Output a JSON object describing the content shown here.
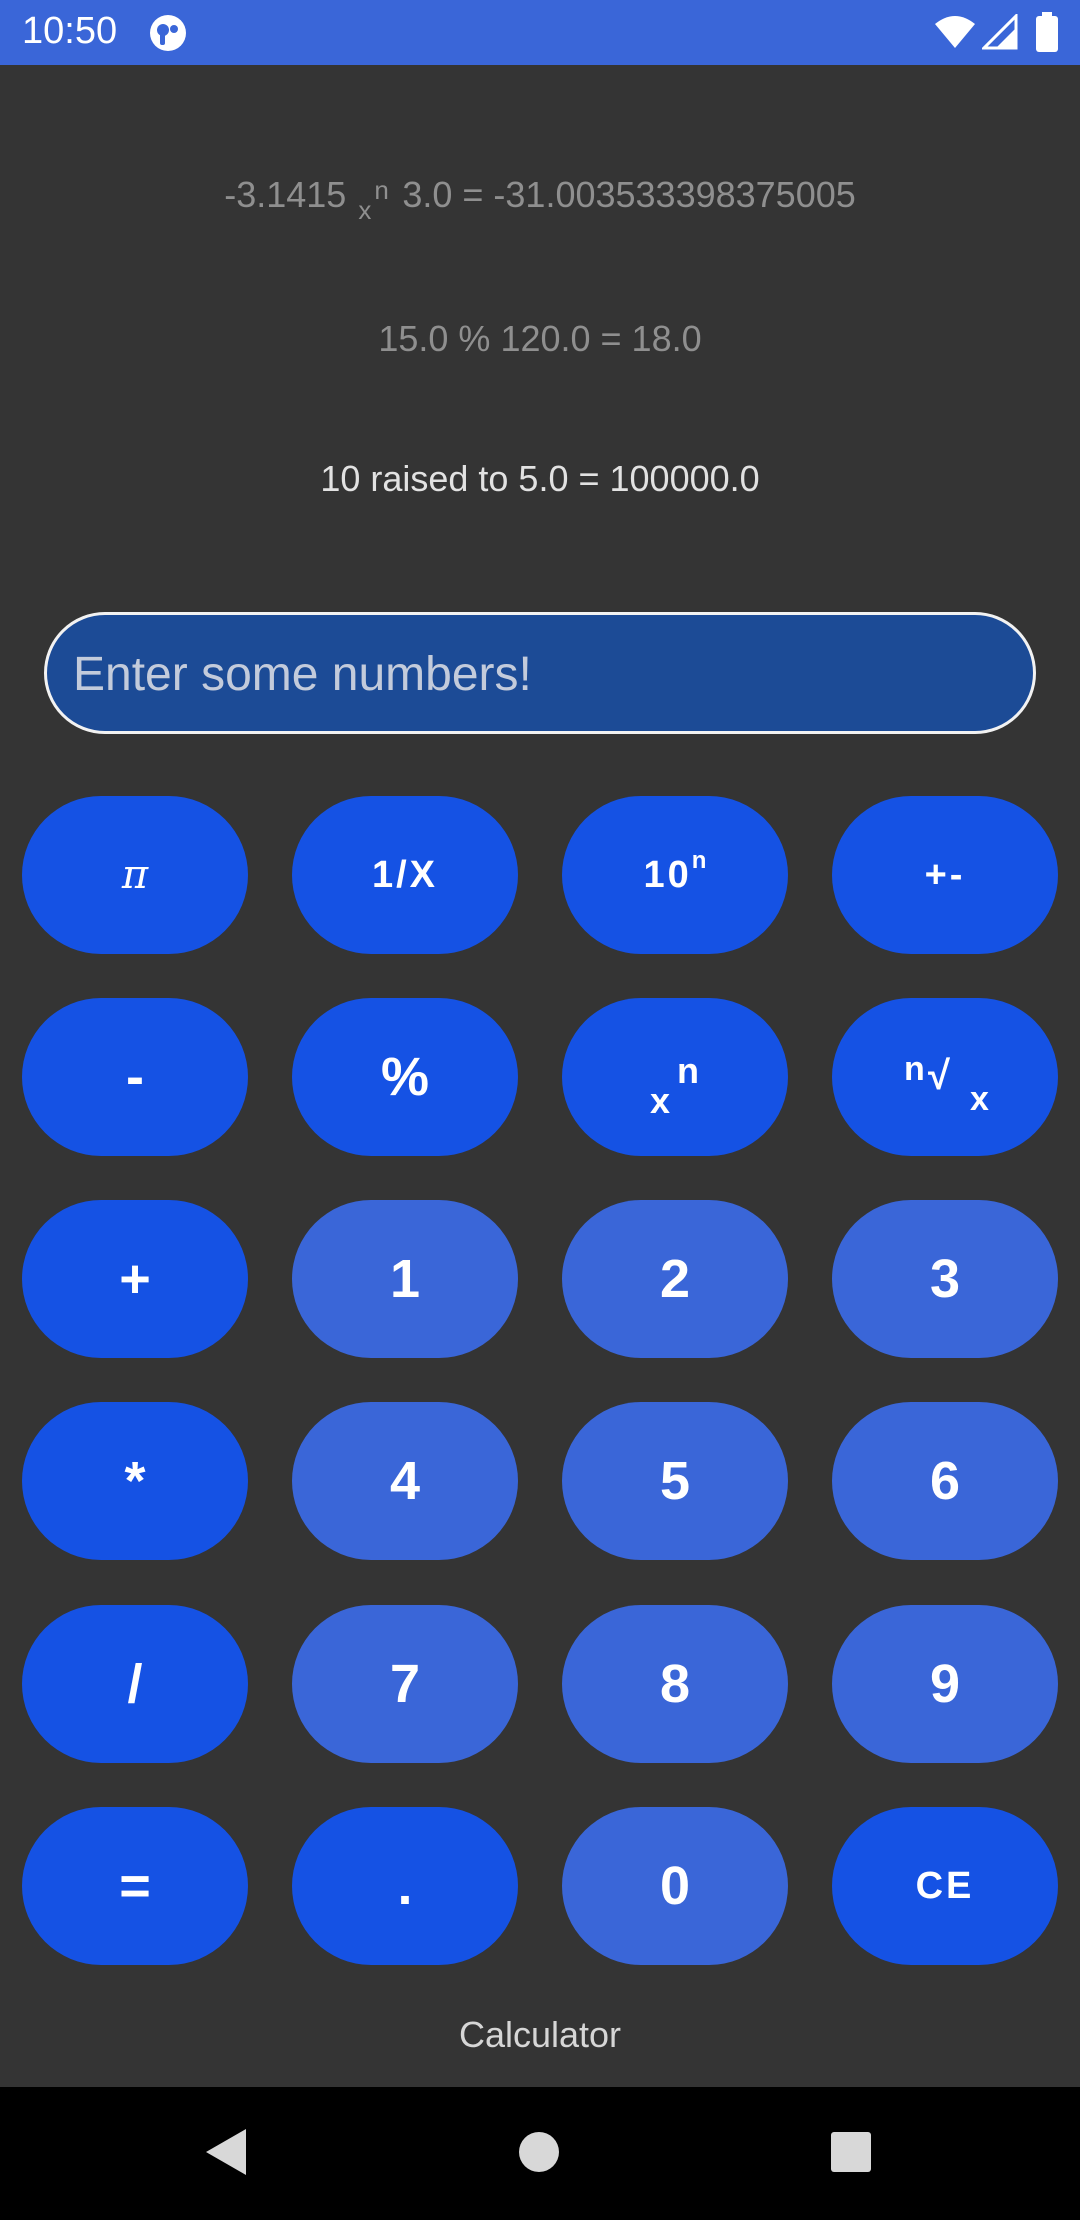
{
  "status_bar": {
    "time": "10:50",
    "icons": [
      "app-notification-icon",
      "wifi-icon",
      "signal-icon",
      "battery-icon"
    ]
  },
  "history": {
    "line1": {
      "left": "-3.1415",
      "op_base": "x",
      "op_exp": "n",
      "right": "3.0 = -31.003533398375005"
    },
    "line2": "15.0 % 120.0 = 18.0",
    "line3": "10 raised to 5.0 = 100000.0"
  },
  "input": {
    "placeholder": "Enter some numbers!",
    "value": ""
  },
  "keys": {
    "pi": "π",
    "reciprocal": "1/X",
    "ten_pow_base": "10",
    "ten_pow_exp": "n",
    "plus_minus": "+-",
    "minus": "-",
    "percent": "%",
    "power_base": "x",
    "power_exp": "n",
    "root_index": "n",
    "root_sign": "√",
    "root_radicand": "x",
    "plus": "+",
    "one": "1",
    "two": "2",
    "three": "3",
    "multiply": "*",
    "four": "4",
    "five": "5",
    "six": "6",
    "divide": "/",
    "seven": "7",
    "eight": "8",
    "nine": "9",
    "equals": "=",
    "decimal": ".",
    "zero": "0",
    "clear": "CE"
  },
  "footer": {
    "label": "Calculator"
  },
  "colors": {
    "status_bar": "#3a66d8",
    "background": "#343434",
    "operator_key": "#1552e4",
    "number_key": "#3a66d8",
    "input_background": "#1c4b96"
  },
  "nav_bar": {
    "icons": [
      "back-icon",
      "home-icon",
      "recents-icon"
    ]
  }
}
